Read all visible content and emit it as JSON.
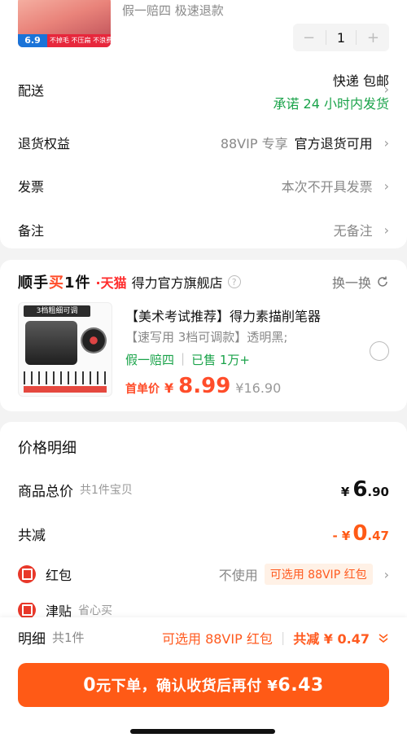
{
  "top": {
    "thumb_price": "6.9",
    "thumb_strip": "不掉毛 不压扁 不浪费",
    "guarantee": "假一赔四  极速退款",
    "stepper": {
      "minus": "−",
      "qty": "1",
      "plus": "+"
    }
  },
  "rows": {
    "shipping": {
      "label": "配送",
      "method": "快递 包邮",
      "promise": "承诺 24 小时内发货"
    },
    "returns": {
      "label": "退货权益",
      "vip": "88VIP 专享",
      "value": "官方退货可用"
    },
    "invoice": {
      "label": "发票",
      "value": "本次不开具发票"
    },
    "note": {
      "label": "备注",
      "value": "无备注"
    }
  },
  "recommend": {
    "brand_black": "顺手",
    "brand_orange": "买",
    "brand_black2": "1件",
    "tmall": "·天猫",
    "store": "得力官方旗舰店",
    "swap": "换一换",
    "img_banner": "3档粗细可调",
    "title": "【美术考试推荐】得力素描削笔器",
    "subtitle": "【速写用 3档可调款】透明黑;",
    "guarantee": "假一赔四",
    "sold": "已售 1万+",
    "price_label": "首单价",
    "currency": "¥",
    "price": "8.99",
    "orig_price": "¥16.90"
  },
  "detail": {
    "title": "价格明细",
    "total": {
      "label": "商品总价",
      "sub": "共1件宝贝",
      "cur": "¥",
      "int": "6",
      "dec": ".90"
    },
    "discount": {
      "label": "共减",
      "prefix": "- ¥",
      "int": "0",
      "dec": ".47"
    },
    "redpacket": {
      "label": "红包",
      "unused": "不使用",
      "badge": "可选用 88VIP 红包"
    },
    "clipped": {
      "label": "津贴",
      "sub": "省心买"
    }
  },
  "bottom": {
    "label": "明细",
    "sub": "共1件",
    "vip": "可选用 88VIP 红包",
    "reduce": "共减 ¥ 0.47",
    "cta_zero": "0",
    "cta_text": "元下单，确认收货后再付 ¥ ",
    "cta_amount": "6.43"
  },
  "colors": {
    "accent": "#ff5a16",
    "green": "#1aa34a",
    "red": "#e8382a"
  }
}
